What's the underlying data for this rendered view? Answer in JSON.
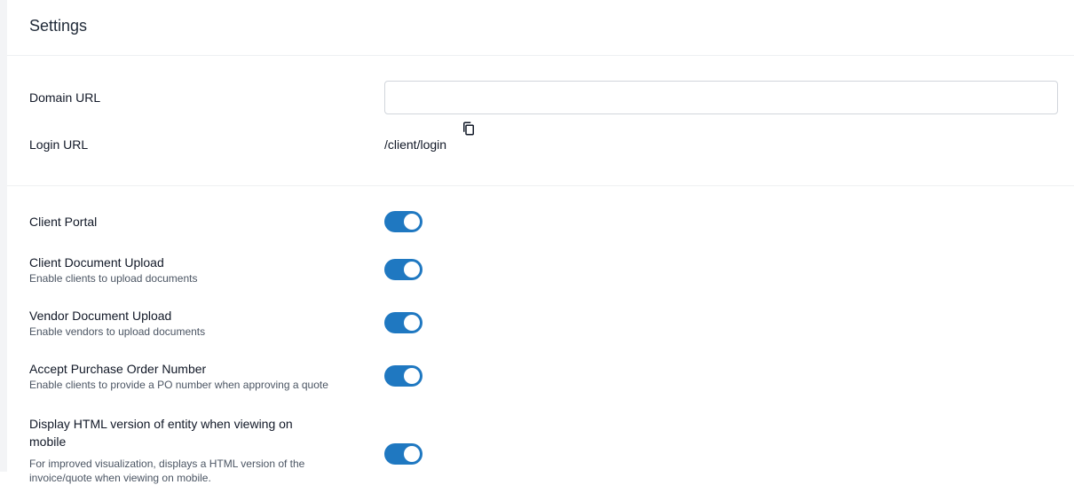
{
  "card": {
    "title": "Settings"
  },
  "section_a": {
    "domain": {
      "label": "Domain URL",
      "value": "",
      "placeholder": ""
    },
    "login": {
      "label": "Login URL",
      "value": "/client/login",
      "copy_icon": "copy-icon"
    }
  },
  "toggles": [
    {
      "label": "Client Portal",
      "description": "",
      "enabled": true
    },
    {
      "label": "Client Document Upload",
      "description": "Enable clients to upload documents",
      "enabled": true
    },
    {
      "label": "Vendor Document Upload",
      "description": "Enable vendors to upload documents",
      "enabled": true
    },
    {
      "label": "Accept Purchase Order Number",
      "description": "Enable clients to provide a PO number when approving a quote",
      "enabled": true
    },
    {
      "label": "Display HTML version of entity when viewing on mobile",
      "description": "For improved visualization, displays a HTML version of the invoice/quote when viewing on mobile.",
      "enabled": true
    }
  ],
  "colors": {
    "toggle_on": "#1f78c1",
    "divider": "#eef0f2"
  }
}
